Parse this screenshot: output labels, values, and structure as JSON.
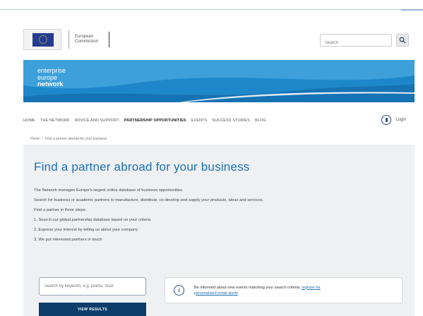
{
  "header": {
    "logo_line1": "European",
    "logo_line2": "Commission",
    "search_placeholder": "Search"
  },
  "banner": {
    "line1": "enterprise",
    "line2": "europe",
    "line3": "network"
  },
  "nav": {
    "items": [
      {
        "label": "HOME"
      },
      {
        "label": "THE NETWORK"
      },
      {
        "label": "ADVICE AND SUPPORT"
      },
      {
        "label": "PARTNERSHIP OPPORTUNITIES",
        "active": true
      },
      {
        "label": "EVENTS"
      },
      {
        "label": "SUCCESS STORIES"
      },
      {
        "label": "BLOG"
      }
    ],
    "login_label": "Login"
  },
  "breadcrumb": {
    "home": "Home",
    "sep": "/",
    "current": "Find a partner abroad for your business"
  },
  "main": {
    "title": "Find a partner abroad for your business",
    "intro": "The Network manages Europe's largest online database of business opportunities.",
    "description": "Search for business or academic partners to manufacture, distribute, co-develop and supply your products, ideas and services.",
    "steps_intro": "Find a partner in three steps:",
    "steps": [
      "1. Search our global partnership database based on your criteria",
      "2. Express your interest by telling us about your company",
      "3. We put interested partners in touch"
    ],
    "keyword_placeholder": "Search by keyword, e.g. plants, food",
    "view_button": "VIEW RESULTS",
    "alert_text": "Be informed about new events matching your search criteria:",
    "alert_link_1": "register for",
    "alert_link_2": "personalised email alerts"
  },
  "colors": {
    "banner_blue": "#1d87c9",
    "title_blue": "#1b6fb0",
    "button_navy": "#0e3d6b",
    "panel_grey": "#eef0f2"
  },
  "icons": {
    "search": "search-icon",
    "login": "user-icon",
    "info": "info-icon"
  }
}
